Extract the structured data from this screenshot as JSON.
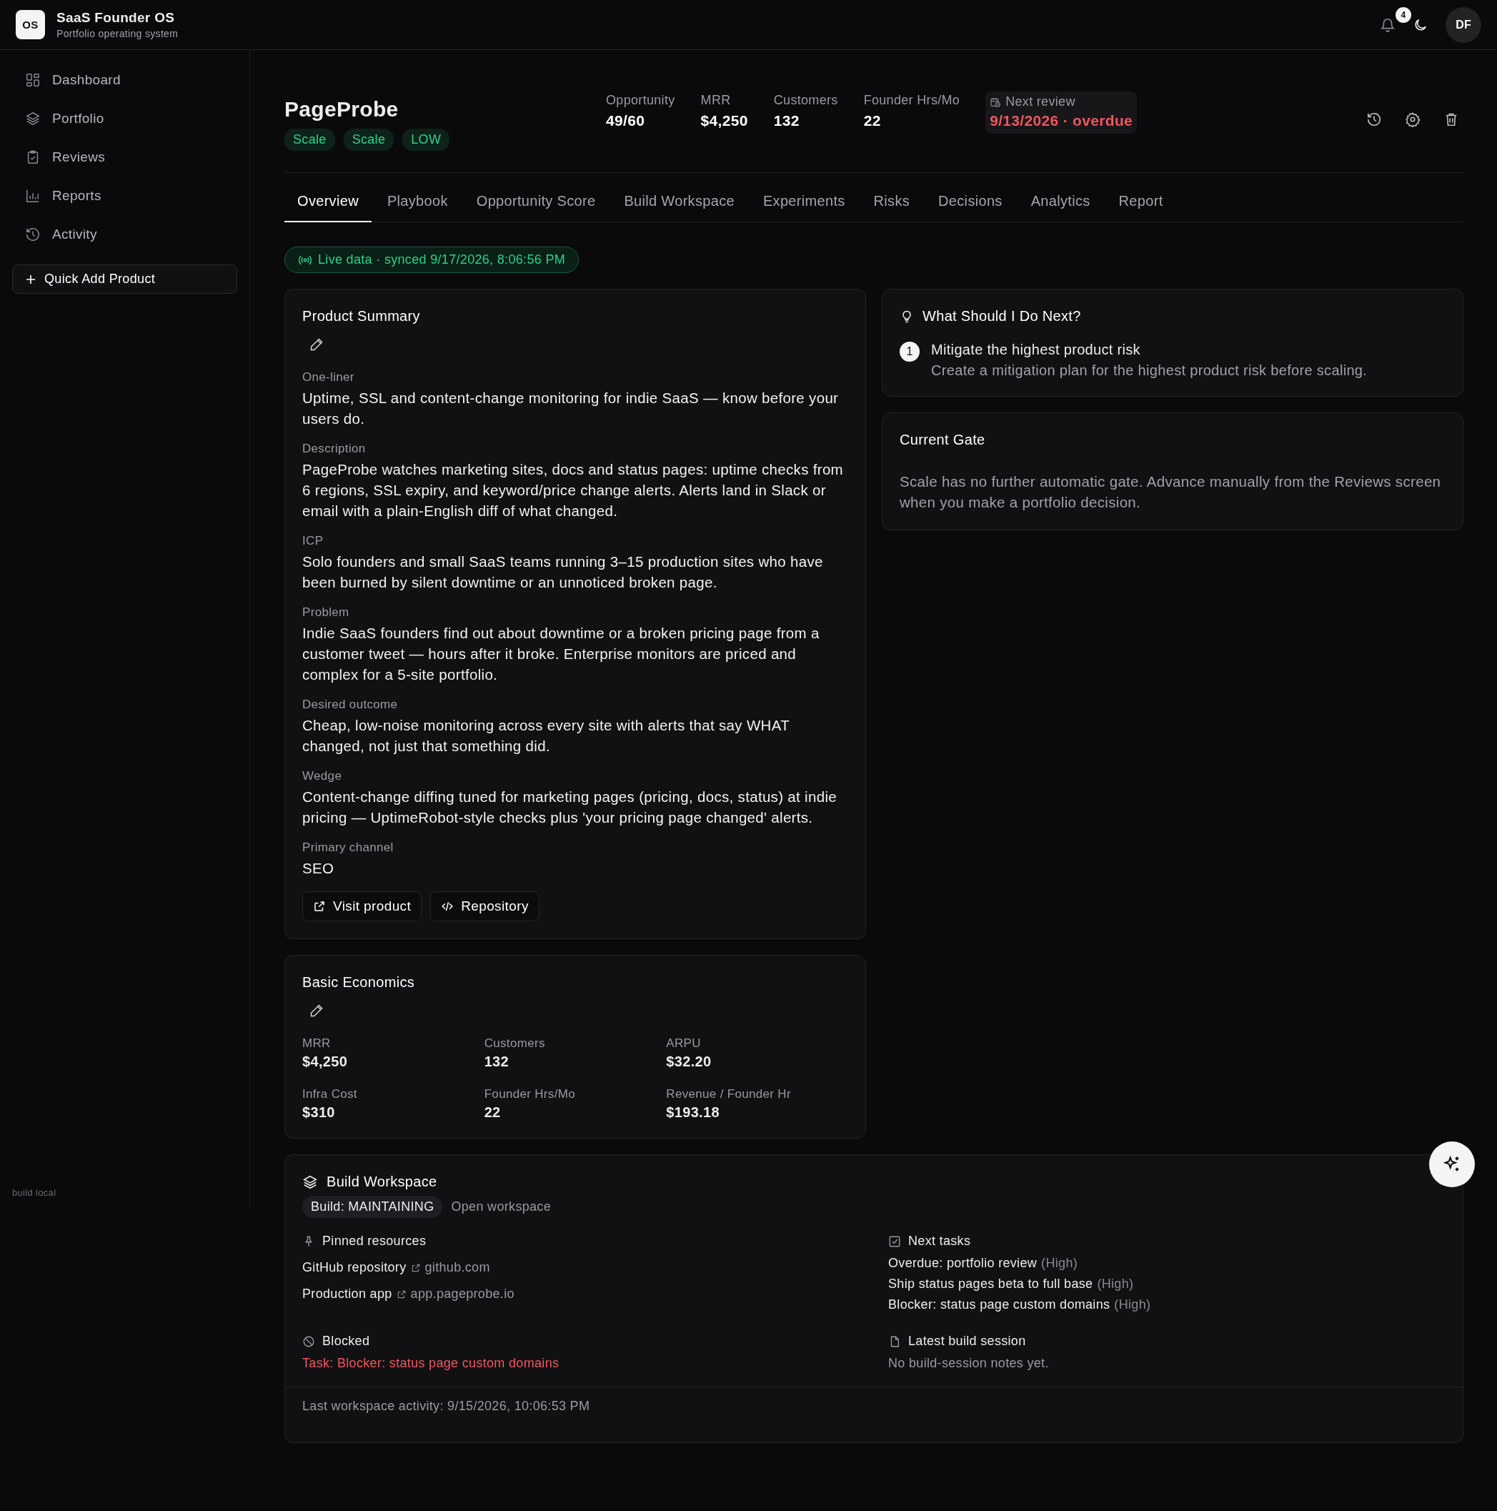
{
  "app": {
    "logo": "OS",
    "name": "SaaS Founder OS",
    "subtitle": "Portfolio operating system"
  },
  "topbar": {
    "notifications": "4",
    "avatar": "DF"
  },
  "sidebar": {
    "items": [
      {
        "label": "Dashboard",
        "selected": false
      },
      {
        "label": "Portfolio",
        "selected": false
      },
      {
        "label": "Reviews",
        "selected": false
      },
      {
        "label": "Reports",
        "selected": false
      },
      {
        "label": "Activity",
        "selected": false
      }
    ],
    "quick_add": "Quick Add Product",
    "build_label": "build local"
  },
  "product": {
    "name": "PageProbe",
    "tags": [
      "Scale",
      "Scale",
      "LOW"
    ],
    "metrics": [
      {
        "label": "Opportunity",
        "value": "49/60"
      },
      {
        "label": "MRR",
        "value": "$4,250"
      },
      {
        "label": "Customers",
        "value": "132"
      },
      {
        "label": "Founder Hrs/Mo",
        "value": "22"
      }
    ],
    "next_review": {
      "label": "Next review",
      "value": "9/13/2026 · overdue",
      "overdue": true
    }
  },
  "tabs": [
    {
      "label": "Overview",
      "selected": true
    },
    {
      "label": "Playbook",
      "selected": false
    },
    {
      "label": "Opportunity Score",
      "selected": false
    },
    {
      "label": "Build Workspace",
      "selected": false
    },
    {
      "label": "Experiments",
      "selected": false
    },
    {
      "label": "Risks",
      "selected": false
    },
    {
      "label": "Decisions",
      "selected": false
    },
    {
      "label": "Analytics",
      "selected": false
    },
    {
      "label": "Report",
      "selected": false
    }
  ],
  "live_status": "Live data · synced 9/17/2026, 8:06:56 PM",
  "product_summary": {
    "title": "Product Summary",
    "fields": [
      {
        "label": "One-liner",
        "value": "Uptime, SSL and content-change monitoring for indie SaaS — know before your users do."
      },
      {
        "label": "Description",
        "value": "PageProbe watches marketing sites, docs and status pages: uptime checks from 6 regions, SSL expiry, and keyword/price change alerts. Alerts land in Slack or email with a plain-English diff of what changed."
      },
      {
        "label": "ICP",
        "value": "Solo founders and small SaaS teams running 3–15 production sites who have been burned by silent downtime or an unnoticed broken page."
      },
      {
        "label": "Problem",
        "value": "Indie SaaS founders find out about downtime or a broken pricing page from a customer tweet — hours after it broke. Enterprise monitors are priced and complex for a 5-site portfolio."
      },
      {
        "label": "Desired outcome",
        "value": "Cheap, low-noise monitoring across every site with alerts that say WHAT changed, not just that something did."
      },
      {
        "label": "Wedge",
        "value": "Content-change diffing tuned for marketing pages (pricing, docs, status) at indie pricing — UptimeRobot-style checks plus 'your pricing page changed' alerts."
      },
      {
        "label": "Primary channel",
        "value": "SEO"
      }
    ],
    "links": [
      {
        "label": "Visit product",
        "kind": "external"
      },
      {
        "label": "Repository",
        "kind": "code"
      }
    ]
  },
  "basic_economics": {
    "title": "Basic Economics",
    "fields": [
      {
        "label": "MRR",
        "value": "$4,250"
      },
      {
        "label": "Customers",
        "value": "132"
      },
      {
        "label": "ARPU",
        "value": "$32.20"
      },
      {
        "label": "Infra Cost",
        "value": "$310"
      },
      {
        "label": "Founder Hrs/Mo",
        "value": "22"
      },
      {
        "label": "Revenue / Founder Hr",
        "value": "$193.18"
      }
    ]
  },
  "next_steps": {
    "title": "What Should I Do Next?",
    "items": [
      {
        "number": "1",
        "title": "Mitigate the highest product risk",
        "description": "Create a mitigation plan for the highest product risk before scaling."
      }
    ]
  },
  "current_gate": {
    "title": "Current Gate",
    "text": "Scale has no further automatic gate. Advance manually from the Reviews screen when you make a portfolio decision."
  },
  "build_workspace": {
    "title": "Build Workspace",
    "status": "Build: MAINTAINING",
    "open_link": "Open workspace",
    "pinned": {
      "title": "Pinned resources",
      "resources": [
        {
          "name": "GitHub repository",
          "url": "github.com"
        },
        {
          "name": "Production app",
          "url": "app.pageprobe.io"
        }
      ]
    },
    "blocked": {
      "title": "Blocked",
      "text": "Task: Blocker: status page custom domains"
    },
    "tasks": {
      "title": "Next tasks",
      "items": [
        {
          "text": "Overdue: portfolio review",
          "priority": "(High)"
        },
        {
          "text": "Ship status pages beta to full base",
          "priority": "(High)"
        },
        {
          "text": "Blocker: status page custom domains",
          "priority": "(High)"
        }
      ]
    },
    "session": {
      "title": "Latest build session",
      "text": "No build-session notes yet."
    },
    "footer": "Last workspace activity: 9/15/2026, 10:06:53 PM"
  }
}
